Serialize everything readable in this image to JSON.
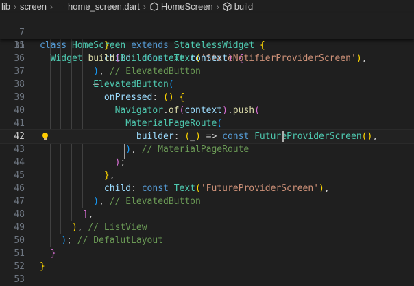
{
  "breadcrumb": {
    "items": [
      "lib",
      "screen",
      "home_screen.dart",
      "HomeScreen",
      "build"
    ]
  },
  "sticky": [
    {
      "num": "7",
      "tokens": [
        [
          "kw",
          "class "
        ],
        [
          "cls",
          "HomeScreen "
        ],
        [
          "kw",
          "extends "
        ],
        [
          "cls",
          "StatelessWidget "
        ],
        [
          "b1",
          "{"
        ]
      ]
    },
    {
      "num": "11",
      "tokens": [
        [
          "cls",
          "  Widget "
        ],
        [
          "fn",
          "build"
        ],
        [
          "b2",
          "("
        ],
        [
          "cls",
          "BuildContext "
        ],
        [
          "prop",
          "context"
        ],
        [
          "b2",
          ")"
        ],
        [
          "p",
          " "
        ],
        [
          "b2",
          "{"
        ]
      ]
    }
  ],
  "lines": [
    {
      "num": "35",
      "tokens": [
        [
          "p",
          "            "
        ],
        [
          "b1",
          "}"
        ],
        [
          "p",
          ","
        ]
      ]
    },
    {
      "num": "36",
      "tokens": [
        [
          "p",
          "            "
        ],
        [
          "prop",
          "child"
        ],
        [
          "p",
          ": "
        ],
        [
          "kw",
          "const "
        ],
        [
          "cls",
          "Text"
        ],
        [
          "b1",
          "("
        ],
        [
          "str",
          "'StateNotifierProviderScreen'"
        ],
        [
          "b1",
          ")"
        ],
        [
          "p",
          ","
        ]
      ]
    },
    {
      "num": "37",
      "tokens": [
        [
          "p",
          "          "
        ],
        [
          "b3",
          ")"
        ],
        [
          "p",
          ", "
        ],
        [
          "cmt",
          "// ElevatedButton"
        ]
      ]
    },
    {
      "num": "38",
      "tokens": [
        [
          "p",
          "          "
        ],
        [
          "cls",
          "ElevatedButton"
        ],
        [
          "b3",
          "("
        ]
      ]
    },
    {
      "num": "39",
      "tokens": [
        [
          "p",
          "            "
        ],
        [
          "prop",
          "onPressed"
        ],
        [
          "p",
          ": "
        ],
        [
          "b1",
          "() {"
        ]
      ]
    },
    {
      "num": "40",
      "tokens": [
        [
          "p",
          "              "
        ],
        [
          "cls",
          "Navigator"
        ],
        [
          "p",
          "."
        ],
        [
          "fn",
          "of"
        ],
        [
          "b2",
          "("
        ],
        [
          "prop",
          "context"
        ],
        [
          "b2",
          ")"
        ],
        [
          "p",
          "."
        ],
        [
          "fn",
          "push"
        ],
        [
          "b2",
          "("
        ]
      ]
    },
    {
      "num": "41",
      "tokens": [
        [
          "p",
          "                "
        ],
        [
          "cls",
          "MaterialPageRoute"
        ],
        [
          "b3",
          "("
        ]
      ]
    },
    {
      "num": "42",
      "tokens": [
        [
          "p",
          "                  "
        ],
        [
          "prop",
          "builder"
        ],
        [
          "p",
          ": "
        ],
        [
          "b1",
          "("
        ],
        [
          "p",
          "_"
        ],
        [
          "b1",
          ")"
        ],
        [
          "p",
          " => "
        ],
        [
          "kw",
          "const "
        ],
        [
          "cls",
          "FutureProviderScreen"
        ],
        [
          "b1",
          "()"
        ],
        [
          "p",
          ","
        ]
      ]
    },
    {
      "num": "43",
      "tokens": [
        [
          "p",
          "                "
        ],
        [
          "b3",
          ")"
        ],
        [
          "p",
          ", "
        ],
        [
          "cmt",
          "// MaterialPageRoute"
        ]
      ]
    },
    {
      "num": "44",
      "tokens": [
        [
          "p",
          "              "
        ],
        [
          "b2",
          ")"
        ],
        [
          "p",
          ";"
        ]
      ]
    },
    {
      "num": "45",
      "tokens": [
        [
          "p",
          "            "
        ],
        [
          "b1",
          "}"
        ],
        [
          "p",
          ","
        ]
      ]
    },
    {
      "num": "46",
      "tokens": [
        [
          "p",
          "            "
        ],
        [
          "prop",
          "child"
        ],
        [
          "p",
          ": "
        ],
        [
          "kw",
          "const "
        ],
        [
          "cls",
          "Text"
        ],
        [
          "b1",
          "("
        ],
        [
          "str",
          "'FutureProviderScreen'"
        ],
        [
          "b1",
          ")"
        ],
        [
          "p",
          ","
        ]
      ]
    },
    {
      "num": "47",
      "tokens": [
        [
          "p",
          "          "
        ],
        [
          "b3",
          ")"
        ],
        [
          "p",
          ", "
        ],
        [
          "cmt",
          "// ElevatedButton"
        ]
      ]
    },
    {
      "num": "48",
      "tokens": [
        [
          "p",
          "        "
        ],
        [
          "b2",
          "]"
        ],
        [
          "p",
          ","
        ]
      ]
    },
    {
      "num": "49",
      "tokens": [
        [
          "p",
          "      "
        ],
        [
          "b1",
          ")"
        ],
        [
          "p",
          ", "
        ],
        [
          "cmt",
          "// ListView"
        ]
      ]
    },
    {
      "num": "50",
      "tokens": [
        [
          "p",
          "    "
        ],
        [
          "b3",
          ")"
        ],
        [
          "p",
          "; "
        ],
        [
          "cmt",
          "// DefalutLayout"
        ]
      ]
    },
    {
      "num": "51",
      "tokens": [
        [
          "p",
          "  "
        ],
        [
          "b2",
          "}"
        ]
      ]
    },
    {
      "num": "52",
      "tokens": [
        [
          "b1",
          "}"
        ]
      ]
    },
    {
      "num": "53",
      "tokens": []
    }
  ],
  "active_line": "42",
  "colors": {
    "background": "#1f1f1f",
    "keyword": "#569cd6",
    "class": "#4ec9b0",
    "function": "#dcdcaa",
    "property": "#9cdcfe",
    "string": "#ce9178",
    "comment": "#6a9955",
    "bracket1": "#ffd700",
    "bracket2": "#da70d6",
    "bracket3": "#179fff"
  },
  "icons": [
    "dart-file-icon",
    "class-icon",
    "method-cube-icon",
    "lightbulb-icon"
  ]
}
